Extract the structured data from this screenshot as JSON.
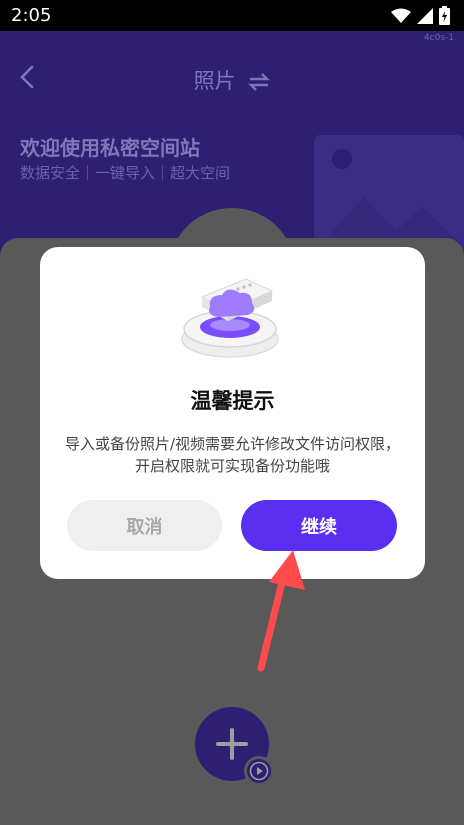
{
  "status_bar": {
    "time": "2:05"
  },
  "header": {
    "build_tag": "4c0s-1",
    "title": "照片",
    "welcome_title": "欢迎使用私密空间站",
    "welcome_subtitle": "数据安全｜一键导入｜超大空间"
  },
  "dialog": {
    "title": "温馨提示",
    "message": "导入或备份照片/视频需要允许修改文件访问权限，开启权限就可实现备份功能哦",
    "cancel_label": "取消",
    "continue_label": "继续"
  },
  "colors": {
    "accent": "#5b2ff0",
    "header_bg": "#2e1f73",
    "arrow": "#ff4b4b"
  }
}
